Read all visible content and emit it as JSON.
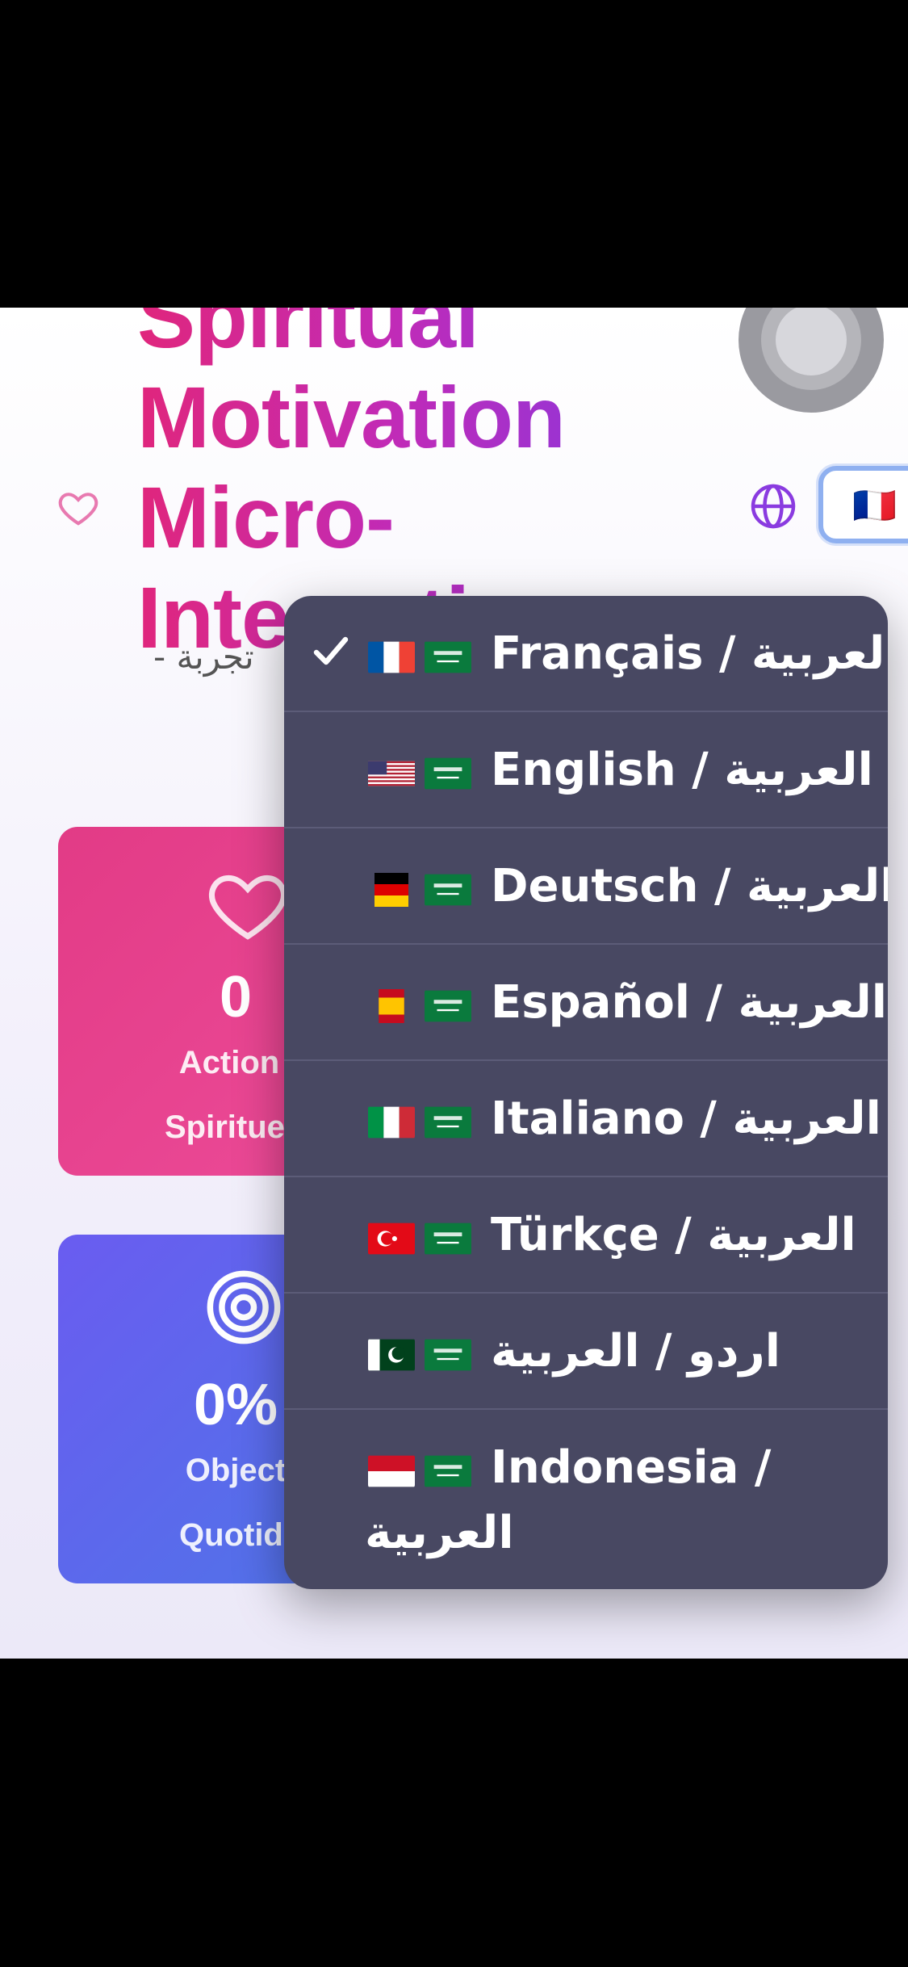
{
  "header": {
    "title_lines": [
      "Spiritual",
      "Motivation",
      "Micro-",
      "Interactions"
    ],
    "subtitle": "تجربة -",
    "language_button_flag": "🇫🇷"
  },
  "cards": [
    {
      "icon": "heart-icon",
      "value": "0",
      "label_line1": "Action",
      "label_line2": "Spirituel"
    },
    {
      "icon": "target-icon",
      "value": "0%",
      "label_line1": "Object",
      "label_line2": "Quotidi"
    }
  ],
  "language_menu": {
    "selected_index": 0,
    "items": [
      {
        "flag1": "fr",
        "label": "Français / العربية"
      },
      {
        "flag1": "us",
        "label": "English / العربية"
      },
      {
        "flag1": "de",
        "label": "Deutsch / العربية"
      },
      {
        "flag1": "es",
        "label": "Español / العربية"
      },
      {
        "flag1": "it",
        "label": "Italiano / العربية"
      },
      {
        "flag1": "tr",
        "label": "Türkçe / العربية"
      },
      {
        "flag1": "pk",
        "label": "اردو / العربية"
      },
      {
        "flag1": "id",
        "label": "Indonesia /",
        "label_line2": "العربية"
      }
    ]
  },
  "colors": {
    "menu_bg": "#484862",
    "title_start": "#e0267c",
    "title_end": "#7a3ae8",
    "card_pink": "#e23b86",
    "card_blue": "#5c6cf0"
  }
}
